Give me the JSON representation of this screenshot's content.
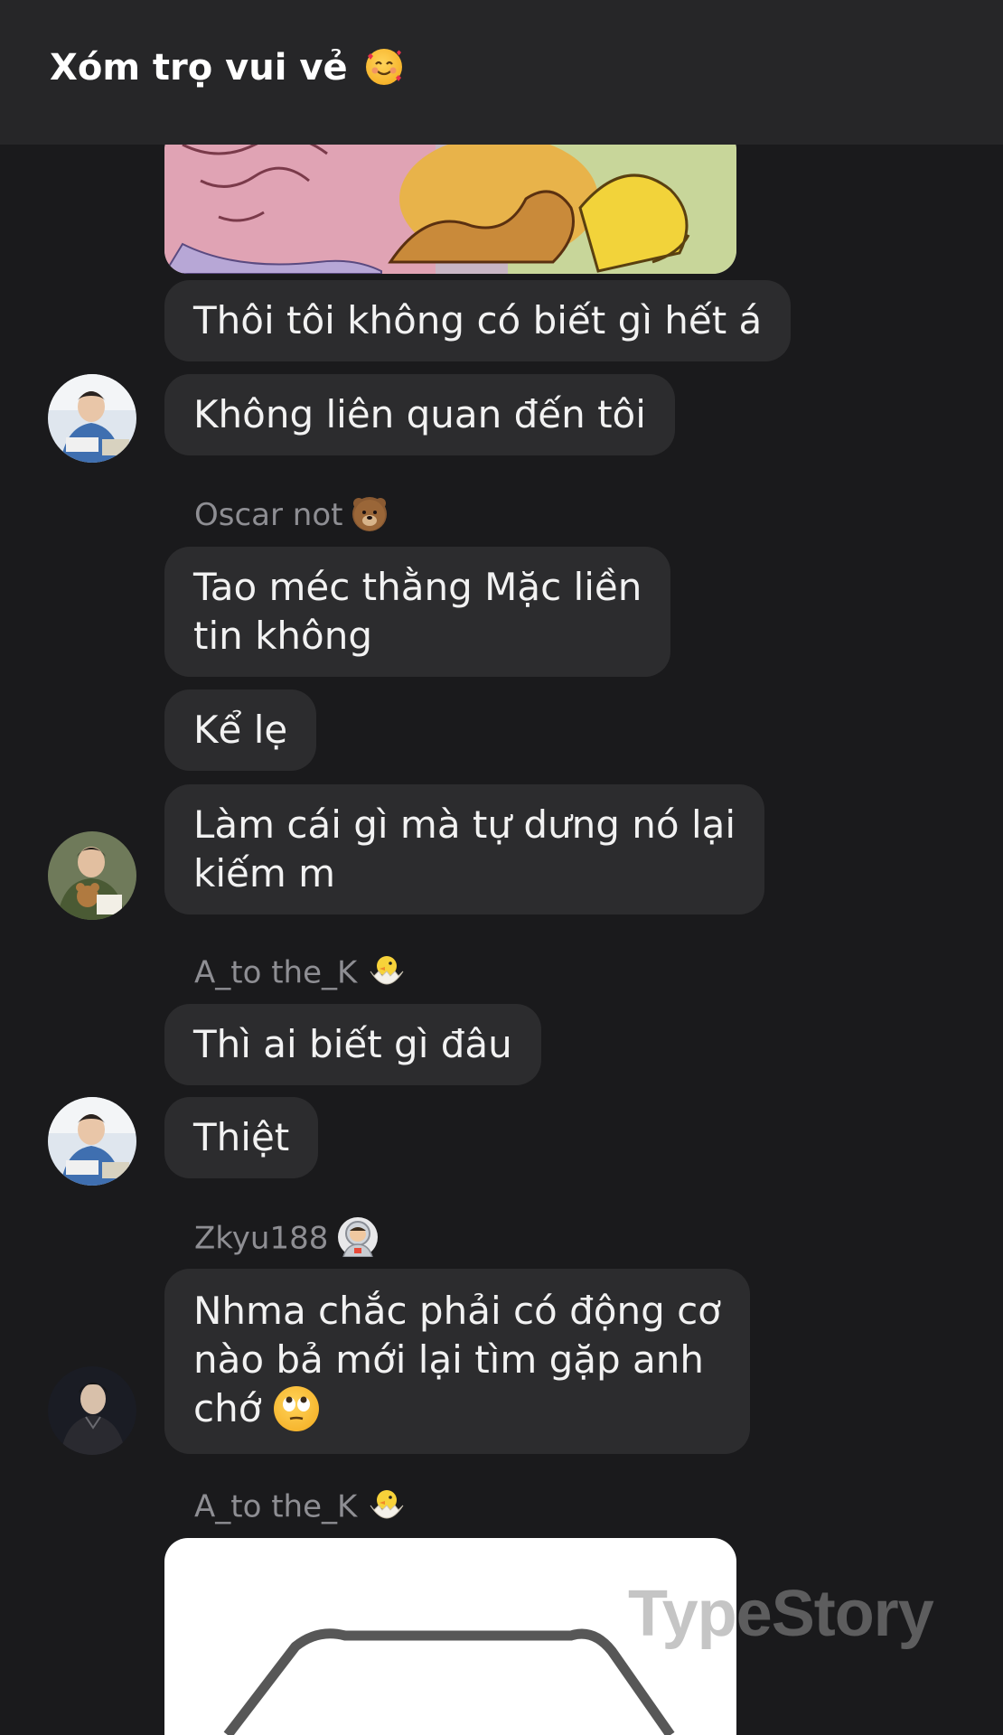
{
  "header": {
    "title": "Xóm trọ vui vẻ",
    "title_emoji": "smiling-face-with-hearts"
  },
  "messages": [
    {
      "type": "image",
      "description_icon": "cartoon-meme-image"
    },
    {
      "type": "text",
      "text": "Thôi tôi không có biết gì hết á"
    },
    {
      "type": "text",
      "text": "Không liên quan đến tôi"
    },
    {
      "type": "sender",
      "name": "Oscar not",
      "emoji": "bear-face"
    },
    {
      "type": "text",
      "line1": "Tao méc thằng Mặc liền",
      "line2": "tin không"
    },
    {
      "type": "text",
      "text": "Kể lẹ"
    },
    {
      "type": "text",
      "line1": "Làm cái gì mà tự dưng nó lại",
      "line2": "kiếm m"
    },
    {
      "type": "sender",
      "name": "A_to the_K",
      "emoji": "hatching-chick"
    },
    {
      "type": "text",
      "text": "Thì ai biết gì đâu"
    },
    {
      "type": "text",
      "text": "Thiệt"
    },
    {
      "type": "sender",
      "name": "Zkyu188",
      "emoji": "astronaut"
    },
    {
      "type": "text",
      "line1": "Nhma chắc phải có động cơ",
      "line2": "nào bả mới lại tìm gặp anh",
      "line3": "chớ",
      "emoji": "face-with-rolling-eyes"
    },
    {
      "type": "sender",
      "name": "A_to the_K",
      "emoji": "hatching-chick"
    },
    {
      "type": "image",
      "description_icon": "sketch-image"
    }
  ],
  "watermark": "TypeStory",
  "colors": {
    "background": "#1a1a1c",
    "header": "#262628",
    "bubble": "#2c2c2e",
    "sender": "#8e8e93"
  }
}
